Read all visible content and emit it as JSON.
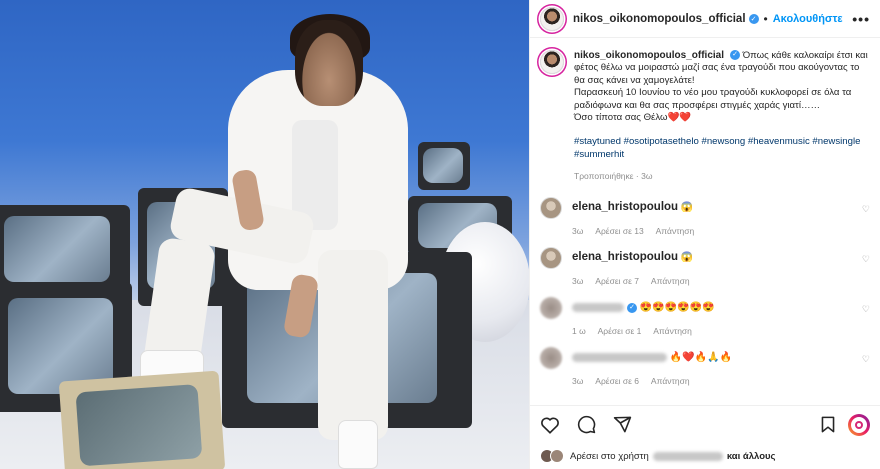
{
  "post": {
    "username": "nikos_oikonomopoulos_official",
    "follow_label": "Ακολουθήστε",
    "separator": "•",
    "more_label": "•••",
    "caption": {
      "username": "nikos_oikonomopoulos_official",
      "text_1": "Όπως κάθε καλοκαίρι έτσι και φέτος θέλω να μοιραστώ μαζί σας ένα τραγούδι που ακούγοντας το θα σας κάνει να χαμογελάτε!",
      "text_2": "Παρασκευή 10 Ιουνίου το νέο μου τραγούδι κυκλοφορεί σε όλα τα ραδιόφωνα και θα σας προσφέρει στιγμές χαράς γιατί……",
      "text_3": "Όσο τίποτα σας Θέλω",
      "hearts": "❤️❤️",
      "tags": "#staytuned #osotipotasethelo #newsong #heavenmusic #newsingle #summerhit"
    },
    "edited": "Τροποποιήθηκε · 3ω"
  },
  "comments": [
    {
      "username": "elena_hristopoulou",
      "text": "😱",
      "time": "3ω",
      "likes": "Αρέσει σε 13",
      "reply": "Απάντηση",
      "blurred": false
    },
    {
      "username": "elena_hristopoulou",
      "text": "😱",
      "time": "3ω",
      "likes": "Αρέσει σε 7",
      "reply": "Απάντηση",
      "blurred": false
    },
    {
      "username": "",
      "text": "😍😍😍😍😍😍",
      "time": "1 ω",
      "likes": "Αρέσει σε 1",
      "reply": "Απάντηση",
      "blurred": true
    },
    {
      "username": "",
      "text": "🔥❤️🔥🙏🔥",
      "time": "3ω",
      "likes": "Αρέσει σε 6",
      "reply": "Απάντηση",
      "blurred": true
    }
  ],
  "likes_bar": {
    "prefix": "Αρέσει στο χρήστη",
    "suffix": "και άλλους"
  },
  "icons": [
    "heart-icon",
    "comment-icon",
    "share-icon",
    "bookmark-icon",
    "more-icon",
    "verified-icon"
  ],
  "colors": {
    "accent": "#0095f6",
    "verified": "#3897f0",
    "meta": "#8e8e8e",
    "hashtag": "#00376b"
  }
}
